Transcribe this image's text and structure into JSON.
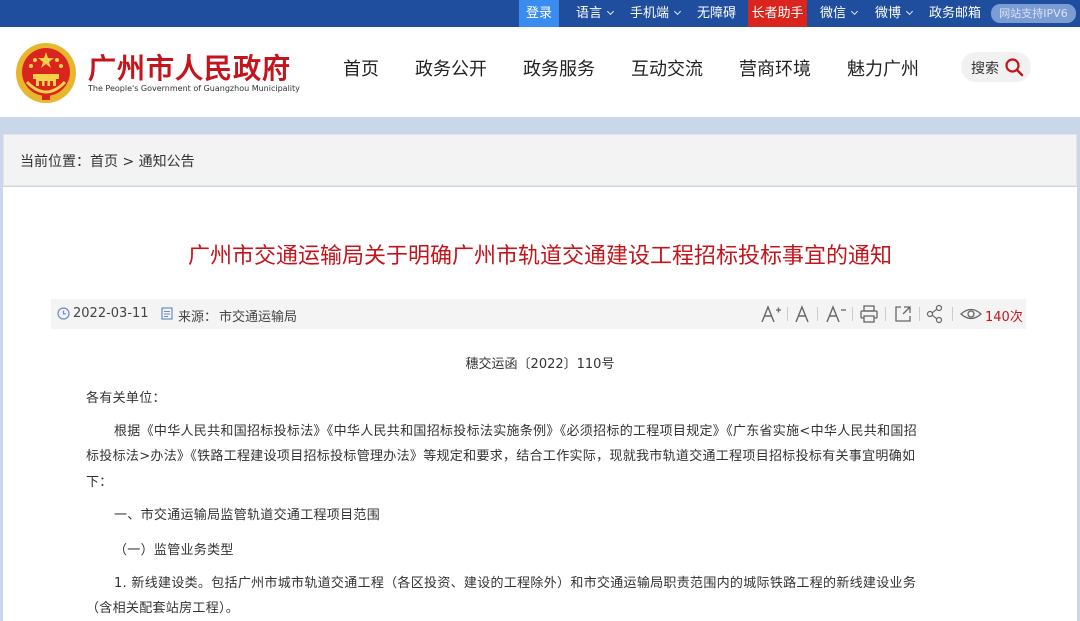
{
  "topbar": {
    "login": "登录",
    "language": "语言",
    "mobile": "手机端",
    "accessible": "无障碍",
    "elder": "长者助手",
    "wechat": "微信",
    "weibo": "微博",
    "email": "政务邮箱",
    "ipv6": "网站支持IPV6",
    "colors": {
      "bar": "#1f4e9f",
      "login": "#3b8cf0",
      "elder": "#d9251d"
    }
  },
  "header": {
    "title": "广州市人民政府",
    "subtitle": "The People's Government of Guangzhou Municipality",
    "nav": [
      "首页",
      "政务公开",
      "政务服务",
      "互动交流",
      "营商环境",
      "魅力广州"
    ],
    "search_label": "搜索",
    "emblem": "national-emblem"
  },
  "breadcrumb": {
    "prefix": "当前位置：",
    "home": "首页",
    "separator": ">",
    "current": "通知公告"
  },
  "article": {
    "title": "广州市交通运输局关于明确广州市轨道交通建设工程招标投标事宜的通知",
    "date": "2022-03-11",
    "source_label": "来源：",
    "source": "市交通运输局",
    "views": "140次",
    "doc_number": "穗交运函〔2022〕110号",
    "salutation": "各有关单位：",
    "p1_line1": "根据《中华人民共和国招标投标法》《中华人民共和国招标投标法实施条例》《必须招标的工程项目规定》《广东省实施<中华人民共和国招",
    "p1_line2": "标投标法>办法》《铁路工程建设项目招标投标管理办法》等规定和要求，结合工作实际，现就我市轨道交通工程项目招标投标有关事宜明确如",
    "p1_line3": "下：",
    "h1": "一、市交通运输局监管轨道交通工程项目范围",
    "h2": "（一）监管业务类型",
    "p2_line1": "1. 新线建设类。包括广州市城市轨道交通工程（各区投资、建设的工程除外）和市交通运输局职责范围内的城际铁路工程的新线建设业务",
    "p2_line2": "（含相关配套站房工程）。"
  },
  "icons": {
    "clock": "clock-icon",
    "doc": "document-icon",
    "font_up": "font-increase-icon",
    "font_normal": "font-normal-icon",
    "font_down": "font-decrease-icon",
    "print": "print-icon",
    "share_out": "share-out-icon",
    "share": "share-icon",
    "eye": "eye-icon",
    "search": "search-icon"
  },
  "colors": {
    "accent": "#c4151c",
    "band": "#c9d7ea"
  }
}
